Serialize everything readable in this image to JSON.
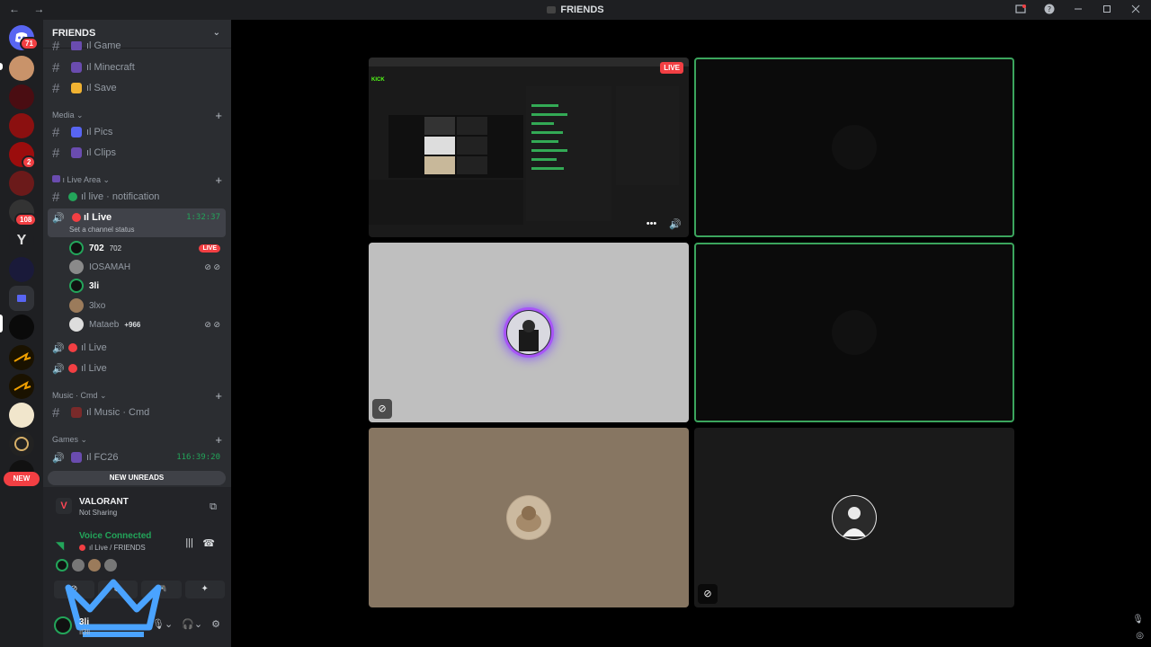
{
  "titlebar": {
    "title": "FRIENDS",
    "back": "←",
    "forward": "→"
  },
  "guilds": {
    "home_badge": "71",
    "badges": {
      "g7": "2",
      "g9": "108"
    },
    "new_label": "NEW"
  },
  "server": {
    "name": "FRIENDS"
  },
  "channels": {
    "game": "ıl Game",
    "minecraft": "ıl Minecraft",
    "save": "ıl Save",
    "cat_media": "Media",
    "pics": "ıl Pics",
    "clips": "ıl Clips",
    "cat_live_area": "ı Live Area",
    "live_notification": "ıl live · notification",
    "live_active": "ıl Live",
    "live_active_time": "1:32:37",
    "live_active_status": "Set a channel status",
    "voice_users": [
      {
        "name": "702",
        "tag": "702",
        "badge": "LIVE"
      },
      {
        "name": "IOSAMAH"
      },
      {
        "name": "3li"
      },
      {
        "name": "3lxo"
      },
      {
        "name": "Mataeb",
        "tag": "+966"
      }
    ],
    "live2": "ıl Live",
    "live3": "ıl Live",
    "cat_music": "Music · Cmd",
    "music_cmd": "ıl Music · Cmd",
    "cat_games": "Games",
    "fc26": "ıl FC26",
    "fc26_time": "116:39:20",
    "new_unreads": "NEW UNREADS"
  },
  "panel": {
    "game_name": "VALORANT",
    "game_sub": "Not Sharing",
    "voice_title": "Voice Connected",
    "voice_sub": "ıl Live / FRIENDS",
    "user_name": "3li",
    "user_status": "ıl3li"
  },
  "stage": {
    "live_tag": "LIVE",
    "stream_more": "•••",
    "stream_vol": "🔊"
  },
  "colors": {
    "accent_green": "#23a55a",
    "live_red": "#f23f43",
    "speaking": "#3ba55d"
  }
}
